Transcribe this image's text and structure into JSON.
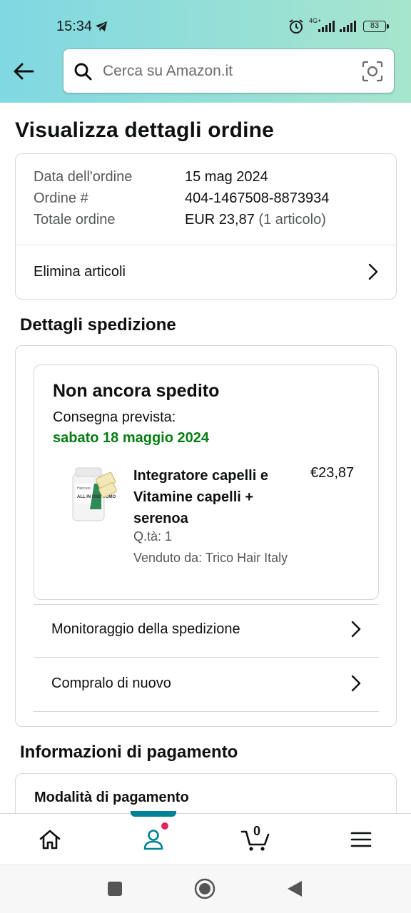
{
  "status_bar": {
    "time": "15:34",
    "network": "4G+",
    "battery": "83"
  },
  "search": {
    "placeholder": "Cerca su Amazon.it"
  },
  "page": {
    "title": "Visualizza dettagli ordine"
  },
  "order_summary": {
    "rows": [
      {
        "label": "Data dell'ordine",
        "value": "15 mag 2024"
      },
      {
        "label": "Ordine #",
        "value": "404-1467508-8873934"
      },
      {
        "label": "Totale ordine",
        "value": "EUR 23,87",
        "extra": "(1 articolo)"
      }
    ],
    "delete_items_label": "Elimina articoli"
  },
  "shipment": {
    "section_title": "Dettagli spedizione",
    "status": "Non ancora spedito",
    "delivery_label": "Consegna prevista:",
    "delivery_date": "sabato 18 maggio 2024",
    "product": {
      "title": "Integratore capelli e Vitamine capelli + serenoa",
      "price": "€23,87",
      "quantity": "Q.tà: 1",
      "seller": "Venduto da: Trico Hair Italy",
      "image_label": "ALL IN ONE UOMO"
    },
    "track_label": "Monitoraggio della spedizione",
    "buy_again_label": "Compralo di nuovo"
  },
  "payment": {
    "section_title": "Informazioni di pagamento",
    "method_title": "Modalità di pagamento"
  },
  "bottom_nav": {
    "cart_count": "0",
    "items": [
      "home-icon",
      "account-icon",
      "cart-icon",
      "menu-icon"
    ],
    "accent_color": "#008296"
  },
  "colors": {
    "delivery_green": "#067d12",
    "header_gradient_start": "#80d8e2",
    "header_gradient_end": "#a7e5cd"
  }
}
